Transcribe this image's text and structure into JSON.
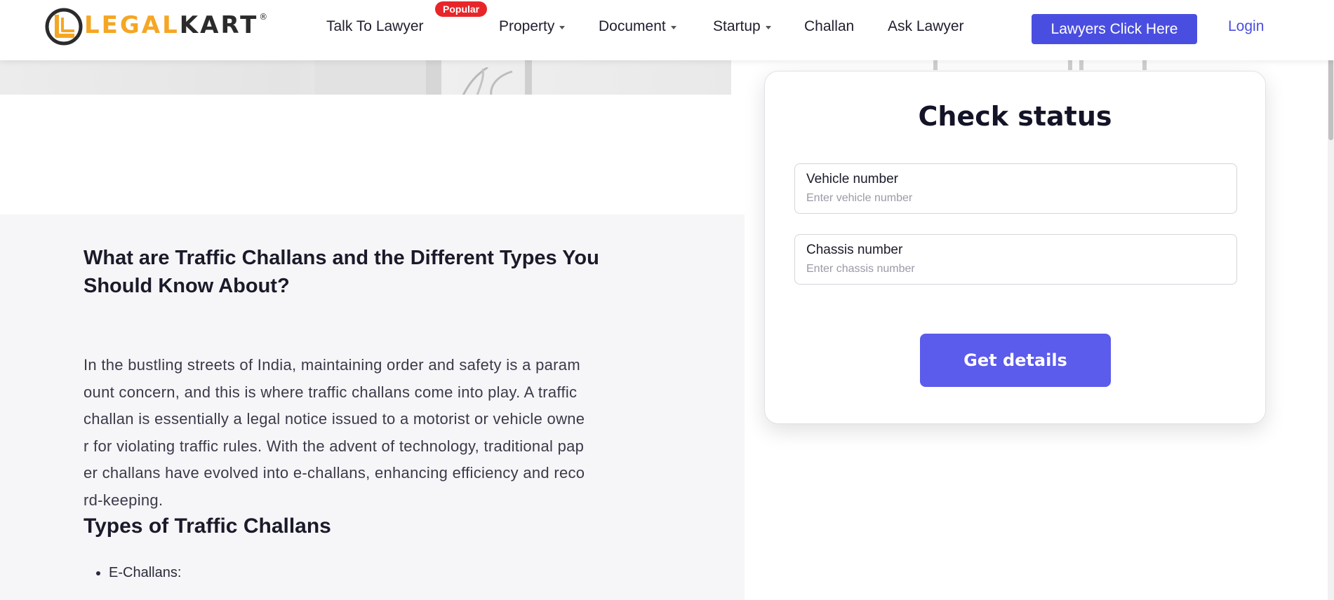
{
  "header": {
    "logo": {
      "text_legal": "LEGAL",
      "text_kart": "KART",
      "registered": "®"
    },
    "nav": {
      "talk_to_lawyer": "Talk To Lawyer",
      "popular_badge": "Popular",
      "property": "Property",
      "document": "Document",
      "startup": "Startup",
      "challan": "Challan",
      "ask_lawyer": "Ask Lawyer"
    },
    "lawyers_button": "Lawyers Click Here",
    "login": "Login"
  },
  "check_status": {
    "title": "Check status",
    "vehicle_label": "Vehicle number",
    "vehicle_placeholder": "Enter vehicle number",
    "chassis_label": "Chassis number",
    "chassis_placeholder": "Enter chassis number",
    "submit": "Get details"
  },
  "article": {
    "title": "What are Traffic Challans and the Different Types You Should Know About?",
    "body_lines": [
      "In the bustling streets of India, maintaining order and safety is a param",
      "ount concern, and this is where traffic challans come into play. A traffic",
      "challan is essentially a legal notice issued to a motorist or vehicle owne",
      "r for violating traffic rules. With the advent of technology, traditional pap",
      "er challans have evolved into e-challans, enhancing efficiency and reco",
      "rd-keeping."
    ],
    "subheading": "Types of Traffic Challans",
    "list": [
      "E-Challans:"
    ]
  },
  "colors": {
    "brand_orange": "#f5a623",
    "primary_button": "#4a4ee0",
    "get_details_button": "#5b5bec",
    "popular_badge": "#e8262a"
  }
}
